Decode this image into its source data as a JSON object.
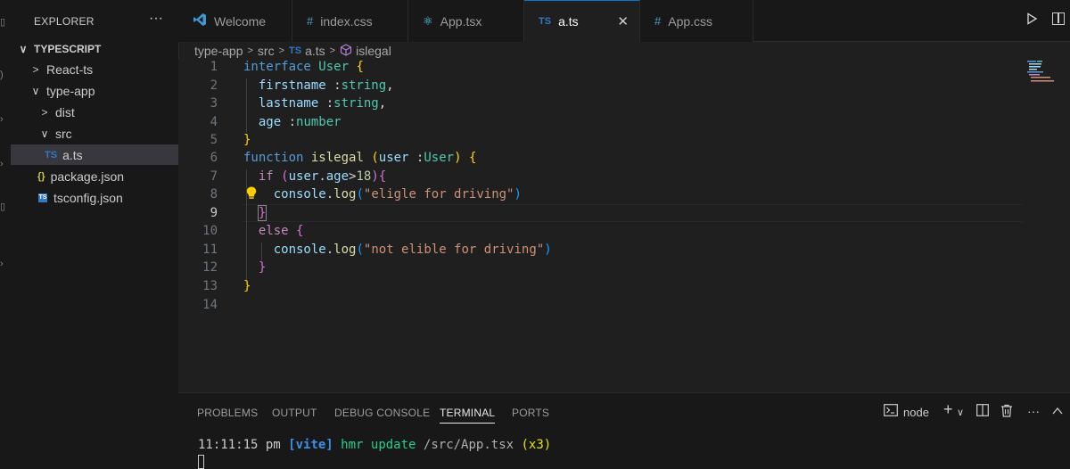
{
  "sidebar": {
    "title": "EXPLORER",
    "more": "···",
    "root": "TYPESCRIPT",
    "items": [
      {
        "label": "React-ts",
        "chev": ">",
        "icon": ""
      },
      {
        "label": "type-app",
        "chev": "∨",
        "icon": ""
      },
      {
        "label": "dist",
        "chev": ">",
        "icon": ""
      },
      {
        "label": "src",
        "chev": "∨",
        "icon": ""
      },
      {
        "label": "a.ts",
        "chev": "",
        "icon": "TS"
      },
      {
        "label": "package.json",
        "chev": "",
        "icon": "{}"
      },
      {
        "label": "tsconfig.json",
        "chev": "",
        "icon": "TS"
      }
    ]
  },
  "tabs": [
    {
      "label": "Welcome",
      "icon": "vscode-icon"
    },
    {
      "label": "index.css",
      "icon": "#"
    },
    {
      "label": "App.tsx",
      "icon": "⚛"
    },
    {
      "label": "a.ts",
      "icon": "TS",
      "active": true,
      "close": "✕"
    },
    {
      "label": "App.css",
      "icon": "#"
    }
  ],
  "breadcrumb": {
    "part1": "type-app",
    "part2": "src",
    "file_icon": "TS",
    "file": "a.ts",
    "symbol": "islegal"
  },
  "editor": {
    "line_numbers": [
      "1",
      "2",
      "3",
      "4",
      "5",
      "6",
      "7",
      "8",
      "9",
      "10",
      "11",
      "12",
      "13",
      "14"
    ],
    "current_line": "9"
  },
  "panel": {
    "tabs": [
      "PROBLEMS",
      "OUTPUT",
      "DEBUG CONSOLE",
      "TERMINAL",
      "PORTS"
    ],
    "active_tab": "TERMINAL",
    "shell": "node",
    "add": "+",
    "dropdown": "∨",
    "more": "···",
    "terminal": {
      "time": "11:11:15 pm",
      "tag": "[vite]",
      "msg": "hmr update",
      "path": "/src/App.tsx",
      "count": "(x3)"
    }
  },
  "colors": {
    "accent": "#0078d4",
    "ts_blue": "#3178c6",
    "keyword": "#569cd6",
    "type": "#4ec9b0",
    "string": "#ce9178"
  }
}
